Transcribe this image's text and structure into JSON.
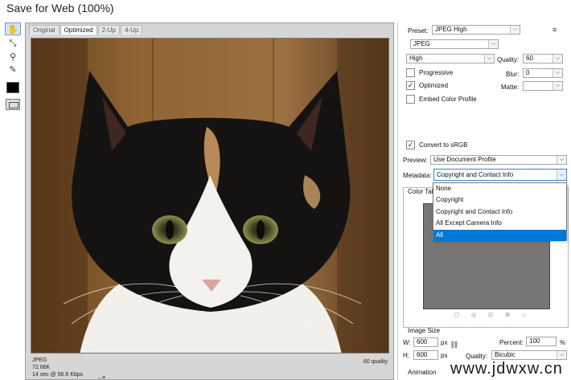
{
  "window": {
    "title": "Save for Web (100%)"
  },
  "tools": [
    "hand-icon",
    "slice-select-icon",
    "zoom-icon",
    "eyedropper-icon"
  ],
  "view": {
    "tabs": [
      "Original",
      "Optimized",
      "2-Up",
      "4-Up"
    ],
    "active_tab": "Optimized",
    "info": {
      "format": "JPEG",
      "size": "72.66K",
      "time": "14 sec @ 56.6 Kbps",
      "quality": "60 quality",
      "menu_glyph": "→≡"
    }
  },
  "settings": {
    "preset_label": "Preset:",
    "preset_value": "JPEG High",
    "format_value": "JPEG",
    "compression_value": "High",
    "quality_label": "Quality:",
    "quality_value": "60",
    "blur_label": "Blur:",
    "blur_value": "0",
    "matte_label": "Matte:",
    "matte_value": "",
    "progressive_label": "Progressive",
    "progressive_checked": false,
    "optimized_label": "Optimized",
    "optimized_checked": true,
    "embed_label": "Embed Color Profile",
    "embed_checked": false,
    "convert_label": "Convert to sRGB",
    "convert_checked": true,
    "preview_label": "Preview:",
    "preview_value": "Use Document Profile",
    "metadata_label": "Metadata:",
    "metadata_value": "Copyright and Contact Info",
    "color_table_label": "Color Tal",
    "check_glyph": "✓",
    "arrow_glyph": "⌵",
    "panel_menu_glyph": "≡"
  },
  "metadata_options": [
    "None",
    "Copyright",
    "Copyright and Contact Info",
    "All Except Camera Info",
    "All"
  ],
  "metadata_selected": "All",
  "image_size": {
    "title": "Image Size",
    "w_label": "W:",
    "w_value": "600",
    "h_label": "H:",
    "h_value": "600",
    "unit": "px",
    "percent_label": "Percent:",
    "percent_value": "100",
    "percent_unit": "%",
    "quality_label": "Quality:",
    "quality_value": "Bicubic"
  },
  "animation_label": "Animation",
  "watermark": "www.jdwxw.cn"
}
